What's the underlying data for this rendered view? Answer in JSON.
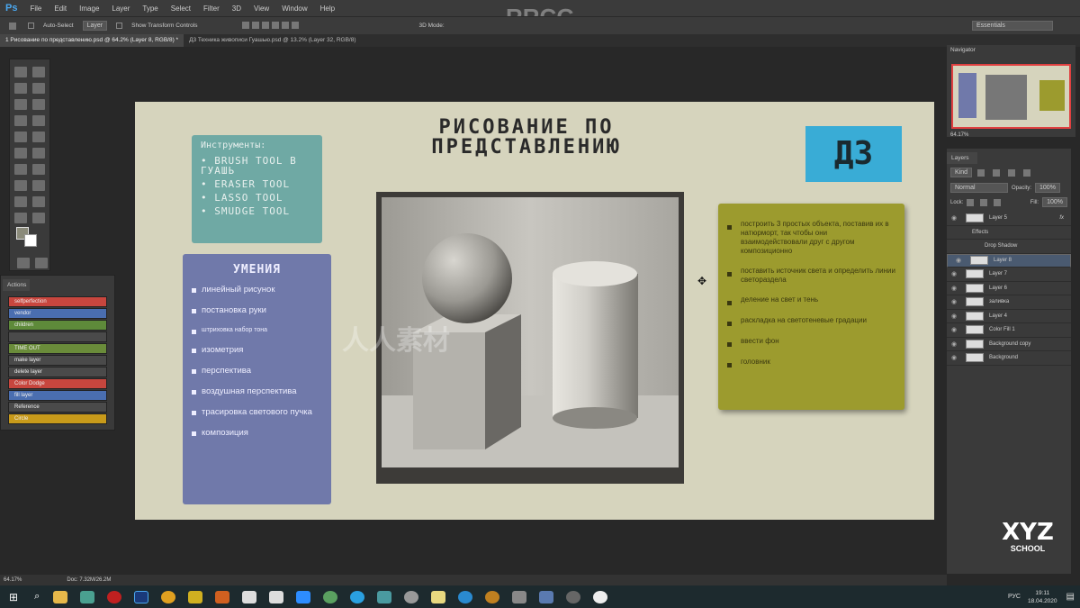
{
  "menubar": {
    "logo": "Ps",
    "items": [
      "File",
      "Edit",
      "Image",
      "Layer",
      "Type",
      "Select",
      "Filter",
      "3D",
      "View",
      "Window",
      "Help"
    ]
  },
  "options": {
    "auto_select": "Auto-Select",
    "layer_select": "Layer",
    "transform": "Show Transform Controls",
    "mode_3d": "3D Mode:",
    "workspace": "Essentials"
  },
  "tabs": [
    {
      "label": "1 Рисование по представлению.psd @ 64.2% (Layer 8, RGB/8) *"
    },
    {
      "label": "Д3 Техника живописи Гуашью.psd @ 13.2% (Layer 32, RGB/8)"
    }
  ],
  "actions": {
    "title": "Actions",
    "items": [
      {
        "label": "selfperfection",
        "color": "#c8463e"
      },
      {
        "label": "vendor",
        "color": "#4a6eb0"
      },
      {
        "label": "children",
        "color": "#5e8a3a"
      },
      {
        "label": "",
        "color": "#4a4a4a"
      },
      {
        "label": "TIME OUT",
        "color": "#6a8c3a"
      },
      {
        "label": "make layer",
        "color": "#4a4a4a"
      },
      {
        "label": "delete layer",
        "color": "#4a4a4a"
      },
      {
        "label": "Color Dodge",
        "color": "#c8463e"
      },
      {
        "label": "fill layer",
        "color": "#4a6eb0"
      },
      {
        "label": "Reference",
        "color": "#4a4a4a"
      },
      {
        "label": "Circle",
        "color": "#c89a1a"
      }
    ]
  },
  "navigator": {
    "title": "Navigator",
    "zoom": "64.17%"
  },
  "layers": {
    "title": "Layers",
    "filter": "Kind",
    "blend": "Normal",
    "opacity_label": "Opacity:",
    "opacity": "100%",
    "lock_label": "Lock:",
    "fill_label": "Fill:",
    "fill": "100%",
    "items": [
      {
        "name": "Layer 5",
        "fx": "fx"
      },
      {
        "name": "Effects",
        "sub": true
      },
      {
        "name": "Drop Shadow",
        "sub": true
      },
      {
        "name": "Layer 8",
        "selected": true
      },
      {
        "name": "Layer 7"
      },
      {
        "name": "Layer 6"
      },
      {
        "name": "заливка"
      },
      {
        "name": "Layer 4"
      },
      {
        "name": "Color Fill 1"
      },
      {
        "name": "Background copy"
      },
      {
        "name": "Background"
      }
    ]
  },
  "status": {
    "zoom": "64.17%",
    "doc": "Doc: 7.32M/26.2M"
  },
  "taskbar": {
    "lang": "РУС",
    "time": "19:11",
    "date": "18.04.2020"
  },
  "watermarks": {
    "top": "RRCG",
    "center": "人人素材",
    "school": "XYZ SCHOOL"
  },
  "doc": {
    "title": "РИСОВАНИЕ ПО ПРЕДСТАВЛЕНИЮ",
    "badge": "Д3",
    "tools": {
      "heading": "Инструменты:",
      "items": [
        "BRUSH TOOL В ГУАШЬ",
        "ERASER TOOL",
        "LASSO TOOL",
        "SMUDGE TOOL"
      ]
    },
    "skills": {
      "heading": "УМЕНИЯ",
      "items": [
        "линейный рисунок",
        "постановка руки",
        "штриховка набор тона",
        "изометрия",
        "перспектива",
        "воздушная перспектива",
        "трасировка светового пучка",
        "композиция"
      ]
    },
    "tasks": [
      "построить 3 простых объекта, поставив их в натюрморт, так чтобы они взаимодействовали друг с другом композиционно",
      "поставить источник света и определить линии светораздела",
      "деление на свет и тень",
      "раскладка на светотеневые градации",
      "ввести фон",
      "головник"
    ]
  }
}
